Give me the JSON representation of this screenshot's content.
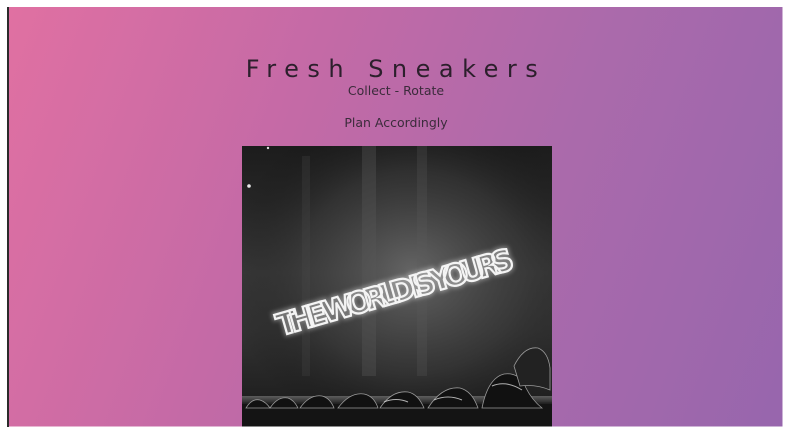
{
  "header": {
    "title": "Fresh Sneakers",
    "subtitle": "Collect - Rotate",
    "tagline": "Plan Accordingly"
  },
  "hero_image": {
    "neon_text": "THE WORLD IS YOURS",
    "description_icon": "neon-sign-sneaker-wall-image"
  },
  "colors": {
    "gradient_start": "#e070a2",
    "gradient_end": "#9766ad",
    "title_text": "#2c1f2c"
  }
}
